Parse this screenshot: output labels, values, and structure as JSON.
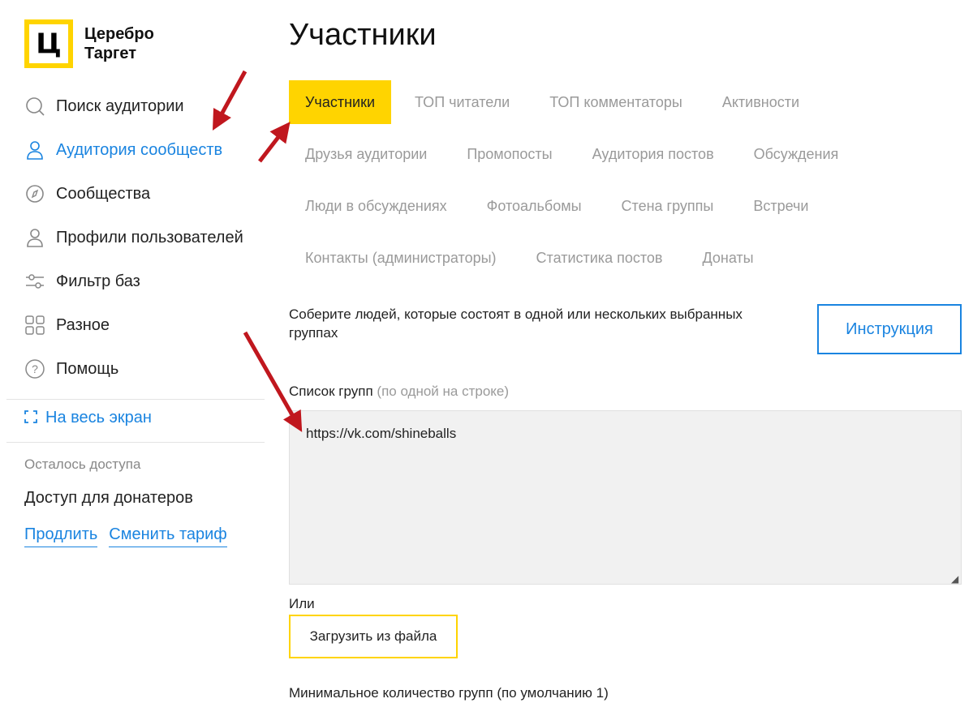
{
  "brand": {
    "logo_letter": "Ц",
    "name_line1": "Церебро",
    "name_line2": "Таргет",
    "color": "#ffd400"
  },
  "sidebar": {
    "items": [
      {
        "label": "Поиск аудитории",
        "icon": "search-icon"
      },
      {
        "label": "Аудитория сообществ",
        "icon": "user-icon",
        "active": true
      },
      {
        "label": "Сообщества",
        "icon": "compass-icon"
      },
      {
        "label": "Профили пользователей",
        "icon": "profile-icon"
      },
      {
        "label": "Фильтр баз",
        "icon": "sliders-icon"
      },
      {
        "label": "Разное",
        "icon": "grid-icon"
      },
      {
        "label": "Помощь",
        "icon": "help-icon"
      }
    ],
    "fullscreen_label": "На весь экран",
    "access_label": "Осталось доступа",
    "access_value": "Доступ для донатеров",
    "extend_label": "Продлить",
    "change_plan_label": "Сменить тариф"
  },
  "main": {
    "title": "Участники",
    "tabs": [
      [
        "Участники",
        "ТОП читатели",
        "ТОП комментаторы",
        "Активности"
      ],
      [
        "Друзья аудитории",
        "Промопосты",
        "Аудитория постов",
        "Обсуждения"
      ],
      [
        "Люди в обсуждениях",
        "Фотоальбомы",
        "Стена группы",
        "Встречи"
      ],
      [
        "Контакты (администраторы)",
        "Статистика постов",
        "Донаты"
      ]
    ],
    "active_tab": "Участники",
    "description": "Соберите людей, которые состоят в одной или нескольких выбранных группах",
    "instruction_button": "Инструкция",
    "group_list_label": "Список групп",
    "group_list_hint": "(по одной на строке)",
    "group_list_value": "https://vk.com/shineballs",
    "or_label": "Или",
    "upload_button": "Загрузить из файла",
    "min_groups_label": "Минимальное количество групп (по умолчанию 1)"
  },
  "colors": {
    "accent": "#1a84e0",
    "highlight": "#ffd400",
    "annotation_arrow": "#c0171e"
  }
}
